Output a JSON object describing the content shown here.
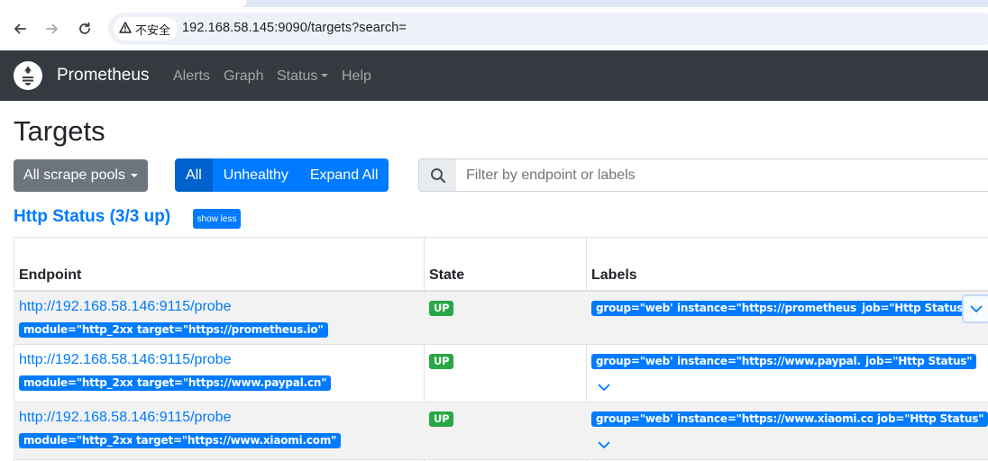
{
  "browser": {
    "security_label": "不安全",
    "url": "192.168.58.145:9090/targets?search="
  },
  "navbar": {
    "brand": "Prometheus",
    "links": [
      "Alerts",
      "Graph",
      "Status",
      "Help"
    ]
  },
  "page": {
    "title": "Targets",
    "pools_button": "All scrape pools",
    "filter_buttons": [
      "All",
      "Unhealthy",
      "Expand All"
    ],
    "filter_placeholder": "Filter by endpoint or labels"
  },
  "pool": {
    "title": "Http Status (3/3 up)",
    "toggle_label": "show less",
    "columns": [
      "Endpoint",
      "State",
      "Labels"
    ],
    "rows": [
      {
        "endpoint": "http://192.168.58.146:9115/probe",
        "params": [
          "module=\"http_2xx\"",
          "target=\"https://prometheus.io\""
        ],
        "state": "UP",
        "labels": [
          "group=\"web\"",
          "instance=\"https://prometheus.io\"",
          "job=\"Http Status\""
        ]
      },
      {
        "endpoint": "http://192.168.58.146:9115/probe",
        "params": [
          "module=\"http_2xx\"",
          "target=\"https://www.paypal.cn\""
        ],
        "state": "UP",
        "labels": [
          "group=\"web\"",
          "instance=\"https://www.paypal.cn\"",
          "job=\"Http Status\""
        ]
      },
      {
        "endpoint": "http://192.168.58.146:9115/probe",
        "params": [
          "module=\"http_2xx\"",
          "target=\"https://www.xiaomi.com\""
        ],
        "state": "UP",
        "labels": [
          "group=\"web\"",
          "instance=\"https://www.xiaomi.com\"",
          "job=\"Http Status\""
        ]
      }
    ]
  },
  "icons": [
    "back-arrow-icon",
    "forward-arrow-icon",
    "reload-icon",
    "warning-icon",
    "prometheus-logo-icon",
    "search-icon",
    "chevron-down-icon"
  ],
  "colors": {
    "navbar": "#343a40",
    "primary": "#007bff",
    "secondary": "#6c757d",
    "success": "#28a745"
  }
}
